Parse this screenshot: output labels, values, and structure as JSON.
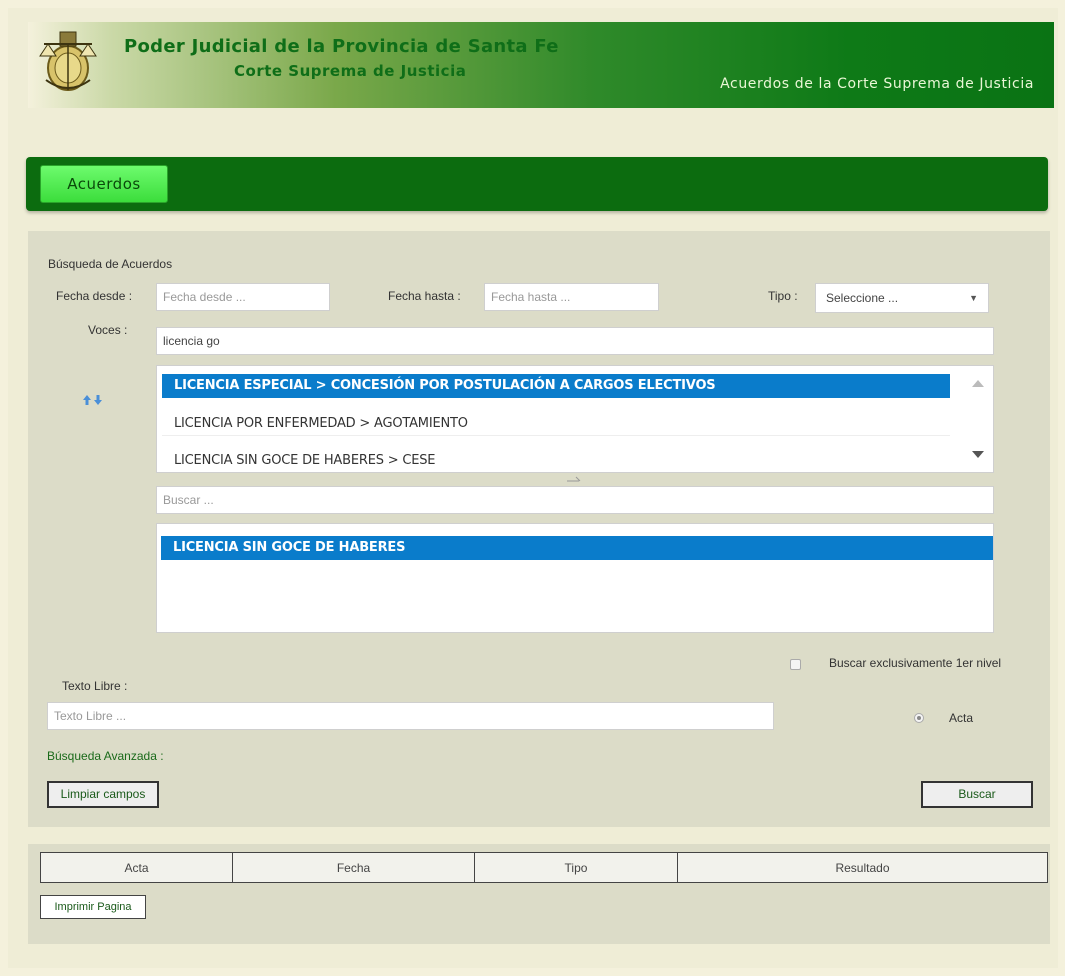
{
  "header": {
    "title": "Poder Judicial de la Provincia de Santa Fe",
    "subtitle": "Corte Suprema de Justicia",
    "right_title": "Acuerdos de la Corte Suprema de Justicia",
    "logo_icon": "court-seal-icon"
  },
  "nav": {
    "tabs": [
      {
        "label": "Acuerdos"
      }
    ]
  },
  "search": {
    "section_title": "Búsqueda de Acuerdos",
    "fecha_desde_label": "Fecha desde :",
    "fecha_desde_placeholder": "Fecha desde ...",
    "fecha_hasta_label": "Fecha hasta :",
    "fecha_hasta_placeholder": "Fecha hasta ...",
    "tipo_label": "Tipo :",
    "tipo_selected": "Seleccione ...",
    "voces_label": "Voces :",
    "voces_value": "licencia go",
    "suggestions": [
      "LICENCIA ESPECIAL > CONCESIÓN POR POSTULACIÓN A CARGOS ELECTIVOS",
      "LICENCIA POR ENFERMEDAD > AGOTAMIENTO",
      "LICENCIA SIN GOCE DE HABERES > CESE"
    ],
    "buscar_placeholder": "Buscar ...",
    "selected_items": [
      "LICENCIA SIN GOCE DE HABERES"
    ],
    "exclusive_label": "Buscar exclusivamente 1er nivel",
    "texto_libre_label": "Texto Libre :",
    "texto_libre_placeholder": "Texto Libre ...",
    "acta_label": "Acta",
    "advanced_label": "Búsqueda Avanzada :",
    "clear_button": "Limpiar campos",
    "search_button": "Buscar"
  },
  "results": {
    "columns": [
      "Acta",
      "Fecha",
      "Tipo",
      "Resultado"
    ],
    "print_button": "Imprimir Pagina"
  },
  "colors": {
    "nav_green": "#0c6c0f",
    "tab_green": "#4ee84e",
    "selection_blue": "#0a7ccb",
    "page_bg": "#f4f1dc"
  }
}
